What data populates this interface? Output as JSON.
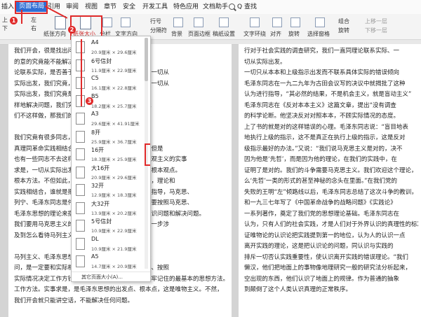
{
  "menu": {
    "items": [
      "插入",
      "页面布局",
      "引用",
      "审阅",
      "视图",
      "章节",
      "安全",
      "开发工具",
      "特色应用",
      "文档助手",
      "Q 查找"
    ],
    "active": "页面布局"
  },
  "ribbon": {
    "margins_top": "上",
    "margins_bottom": "下",
    "margins_left": "左",
    "margins_right": "右",
    "orientation": "纸张方向",
    "paper_size": "纸张大小",
    "columns": "分栏",
    "text_direction": "文字方向",
    "line_numbers": "行号",
    "separator": "分隔符",
    "background": "背景",
    "page_border": "页面边框",
    "draft_paper": "稿纸设置",
    "text_wrap": "文字环绕",
    "align": "对齐",
    "rotate": "旋转",
    "selection_pane": "选择窗格",
    "combine": "组合",
    "move_up": "上移一层",
    "move_down": "下移一层"
  },
  "paper_sizes": [
    {
      "name": "A4",
      "dims": "20.9厘米 × 29.6厘米"
    },
    {
      "name": "6号信封",
      "dims": "11.9厘米 × 22.9厘米"
    },
    {
      "name": "C5",
      "dims": "16.1厘米 × 22.8厘米"
    },
    {
      "name": "B5",
      "dims": "18.2厘米 × 25.7厘米"
    },
    {
      "name": "A3",
      "dims": "29.6厘米 × 41.91厘米"
    },
    {
      "name": "8开",
      "dims": "25.9厘米 × 36.7厘米"
    },
    {
      "name": "16开",
      "dims": "18.3厘米 × 25.9厘米"
    },
    {
      "name": "大16开",
      "dims": "20.9厘米 × 29.6厘米"
    },
    {
      "name": "32开",
      "dims": "12.9厘米 × 18.3厘米"
    },
    {
      "name": "大32开",
      "dims": "13.9厘米 × 20.2厘米"
    },
    {
      "name": "5号信封",
      "dims": "10.9厘米 × 22.9厘米"
    },
    {
      "name": "DL",
      "dims": "10.9厘米 × 21.9厘米"
    },
    {
      "name": "A5",
      "dims": "14.7厘米 × 20.9厘米"
    }
  ],
  "dropdown_footer": "其它页面大小(A)...",
  "annotations": [
    "1",
    "2",
    "3"
  ],
  "doc_left": [
    "我们开会，很是找出问题，解决问题。我们说",
    "的意的究竟能不能解决问题，就是我们是否能够理",
    "论联系实际，是否善于从实际出发，来掌握的态度，一切从",
    "实际出发，我们究竟，都要坚持用实事求是的态度，一切从",
    "实际出发，我们究竟是不是解决了问题，解决问题。",
    "样地解决问题，我们究竟是否在实践中检验。如果我",
    "们不这样做，那我们的认识就不能真正解决问题。",
    "",
    "我们究竟有很多同志，坚持把马列主义的普遍",
    "真理同革命实践相结合，在实际工作中要继续发扬。但是",
    "也有一些同志不去这样做，对于这些同志，要反对主观主义的实事",
    "求是，一切从实际出发，是马列主义和毛泽东思想的根本观点。",
    "根本方法。不但如此，而且我们还要坚持从实际出发，理论和",
    "实践相结合，谁就是把马克思主义和毛泽东思想作为指导，马克思、",
    "列宁、毛泽东同志是伟大的马克思主义者，是主张只要按照马克思、",
    "毛泽东思想的理论来指导实际工作，就能够正确地认识问题和解决问题。",
    "我们要用马克思主义的方法论，指导实践，把问题进一步涉",
    "及到怎么看待马列主义。",
    "",
    "马列主义、毛泽东思想，它是一种科学，它是毫无疑",
    "问，是一定要和实际相结合。我们在工作中不能注解、按照",
    "实际情况决定工作方针，这是一切共产党员所必须牢牢记住的最基本的思想方法。",
    "工作方法。实事求是，是毛泽东思想的出发点、根本点，这是唯物主义。不然，",
    "我们开会就只能讲空话，不能解决任何问题。"
  ],
  "doc_right": [
    "行对于社会实践的调查研究，我们一直同理论联系实际、一",
    "切从实际出发。",
    "一切只从本本和上级指示出发而不联系具体实际的错误倾向",
    "毛泽东同志在一九二九年为古田会议写的决议中就揭批了这种",
    "认为进行指导，“其必然的结果，不是机会主义，就是盲动主义”",
    "毛泽东同志在《反对本本主义》这篇文章，提出“没有调查",
    "的科学论断。他坚决反对对照本本，不顾实际情况的态度。",
    "上了书的就是对的这样错误的心理。毛泽东同志说：“盲目地表",
    "地执行上级的指示，这不是真正在执行上级的指示，这是反对",
    "级指示最好的办法。”又说：“我们说马克思主义是对的，决不",
    "因为他是‘先哲’，而是因为他的理论，在我们的实践中，在",
    "证明了是对的。我们的斗争需要马克思主义。我们欢迎这个理论，",
    "么‘先哲’一类的形式的甚至神秘的念头在里面。”在我们党的",
    "失败的王明“左”倾路线以后，毛泽东同志总结了这次斗争的教训，",
    "和一九三七年写了《中国革命战争的战略问题》《实践论》",
    "一系列著作，奠定了我们党的思想理论基础。毛泽东同志在",
    "认为，只有人们的社会实践，才是人们对于外界认识的真理性的标准，",
    "证唯物论的认识论把实践提到第一的地位，认为人的认识一点",
    "离开实践的理论，这是把认识论的问题，同认识与实践的",
    "排斥一切否认实践重要性，使认识离开实践的错误理论。“我们",
    "懒汉，他们把地面上的事物像地理研究一般的研究法分析起来，",
    "空出现的东西，他们认识了地面上的规律。作为普通的抽象",
    "到颠倒了这个人类认识真理的正常秩序。"
  ]
}
